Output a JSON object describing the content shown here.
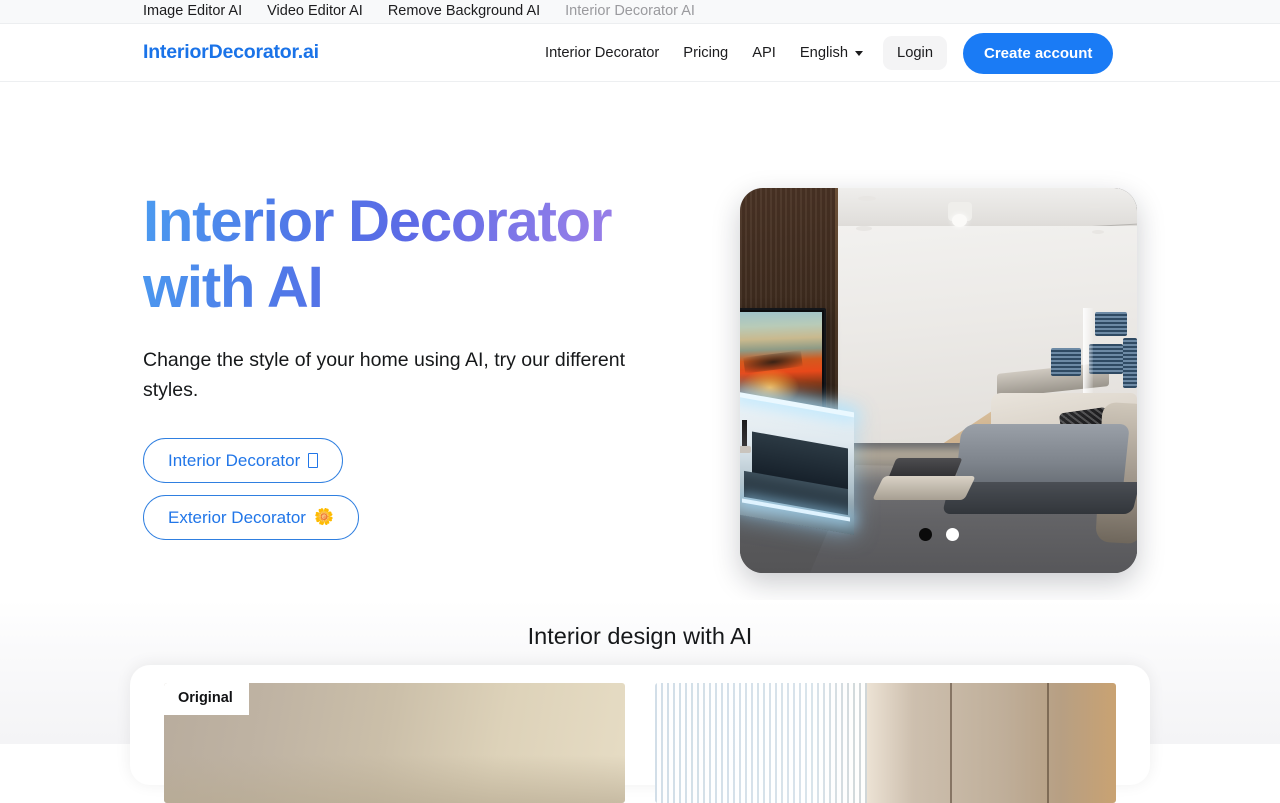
{
  "topbar": {
    "links": [
      {
        "label": "Image Editor AI",
        "muted": false
      },
      {
        "label": "Video Editor AI",
        "muted": false
      },
      {
        "label": "Remove Background AI",
        "muted": false
      },
      {
        "label": "Interior Decorator AI",
        "muted": true
      }
    ]
  },
  "header": {
    "logo": "InteriorDecorator.ai",
    "nav": [
      {
        "label": "Interior Decorator"
      },
      {
        "label": "Pricing"
      },
      {
        "label": "API"
      }
    ],
    "language": {
      "label": "English",
      "caret_icon": "chevron-down-icon"
    },
    "login_label": "Login",
    "create_account_label": "Create account",
    "accent_color": "#1a7bf5",
    "logo_color": "#1a73e8"
  },
  "hero": {
    "title": "Interior Decorator with AI",
    "subtitle": "Change the style of your home using AI, try our different styles.",
    "gradient_from": "#4b9bf0",
    "gradient_mid": "#5b6ae6",
    "gradient_to": "#b07fe6",
    "buttons": [
      {
        "label": "Interior Decorator",
        "glyph": "□",
        "glyph_name": "sofa-emoji-missing-glyph"
      },
      {
        "label": "Exterior Decorator",
        "glyph": "🌼",
        "glyph_name": "blossom-emoji"
      }
    ],
    "image_alt": "Modern living room with TV and sectional sofa",
    "carousel": {
      "dots": [
        {
          "state": "inactive"
        },
        {
          "state": "active"
        }
      ],
      "active_index": 1
    }
  },
  "section": {
    "title": "Interior design with AI",
    "compare": {
      "original_badge": "Original",
      "images": [
        {
          "name": "original-room-image"
        },
        {
          "name": "styled-room-image"
        }
      ]
    }
  }
}
